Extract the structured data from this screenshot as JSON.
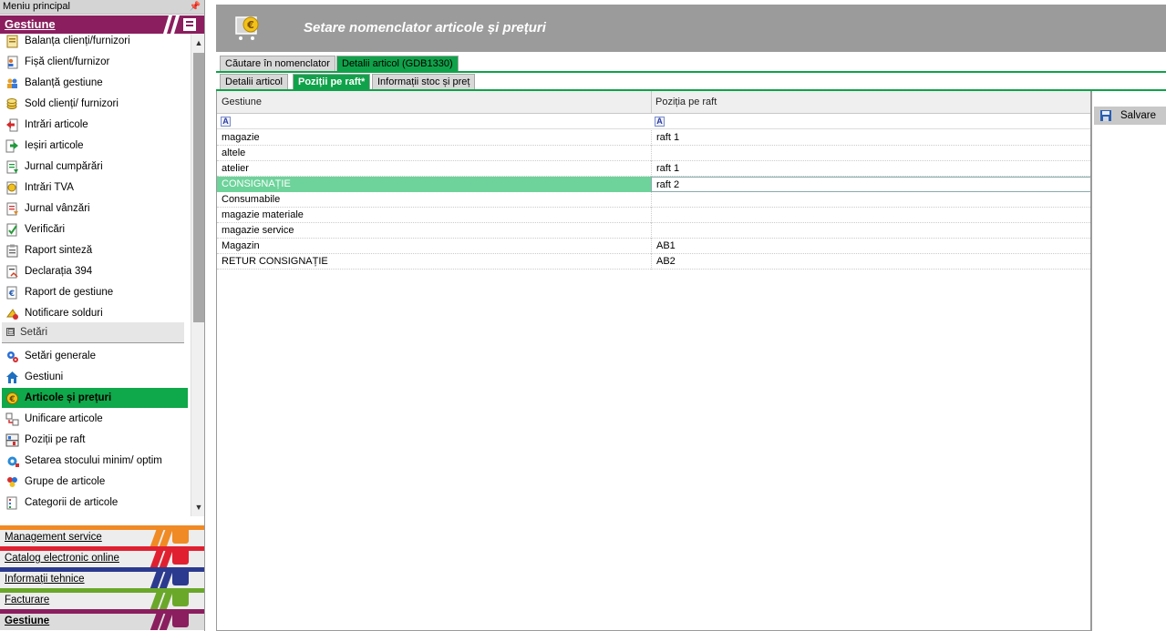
{
  "sidebar": {
    "title": "Meniu principal",
    "pin_icon": "pin-icon",
    "header": "Gestiune",
    "items": [
      {
        "label": "Balanța clienți/furnizori",
        "icon": "report-icon"
      },
      {
        "label": "Fișă client/furnizor",
        "icon": "person-sheet-icon"
      },
      {
        "label": "Balanță gestiune",
        "icon": "people-icon"
      },
      {
        "label": "Sold clienți/ furnizori",
        "icon": "coins-icon"
      },
      {
        "label": "Intrări articole",
        "icon": "arrow-in-icon"
      },
      {
        "label": "Ieșiri articole",
        "icon": "arrow-out-icon"
      },
      {
        "label": "Jurnal cumpărări",
        "icon": "journal-icon"
      },
      {
        "label": "Intrări TVA",
        "icon": "coin-doc-icon"
      },
      {
        "label": "Jurnal vânzări",
        "icon": "journal-sales-icon"
      },
      {
        "label": "Verificări",
        "icon": "check-icon"
      },
      {
        "label": "Raport sinteză",
        "icon": "clipboard-icon"
      },
      {
        "label": "Declarația 394",
        "icon": "declaration-icon"
      },
      {
        "label": "Raport de gestiune",
        "icon": "euro-doc-icon"
      },
      {
        "label": "Notificare solduri",
        "icon": "notify-icon"
      }
    ],
    "section": {
      "label": "Setări",
      "toggle": "⊟"
    },
    "settings_items": [
      {
        "label": "Setări generale",
        "icon": "gears-icon"
      },
      {
        "label": "Gestiuni",
        "icon": "house-icon"
      },
      {
        "label": "Articole și prețuri",
        "icon": "euro-coin-icon",
        "active": true
      },
      {
        "label": "Unificare articole",
        "icon": "merge-icon"
      },
      {
        "label": "Poziții pe raft",
        "icon": "shelf-icon"
      },
      {
        "label": "Setarea stocului minim/ optim",
        "icon": "settings-gear-icon"
      },
      {
        "label": "Grupe de articole",
        "icon": "groups-icon"
      },
      {
        "label": "Categorii de articole",
        "icon": "categories-icon"
      }
    ],
    "modules": [
      {
        "label": "Management service",
        "color": "#f08a24"
      },
      {
        "label": "Catalog electronic online",
        "color": "#e02030"
      },
      {
        "label": "Informații tehnice",
        "color": "#2b3a8f"
      },
      {
        "label": "Facturare",
        "color": "#6aa82a"
      },
      {
        "label": "Gestiune",
        "color": "#8b1e5e"
      }
    ]
  },
  "main": {
    "title": "Setare nomenclator articole și prețuri",
    "banner_icon": "euro-cart-icon",
    "tabs_row1": [
      {
        "label": "Căutare în nomenclator",
        "active": false
      },
      {
        "label": "Detalii articol (GDB1330)",
        "active": true
      }
    ],
    "tabs_row2": [
      {
        "label": "Detalii articol",
        "active": false
      },
      {
        "label": "Poziții pe raft*",
        "active": true
      },
      {
        "label": "Informații stoc și preț",
        "active": false
      }
    ],
    "grid": {
      "columns": [
        "Gestiune",
        "Poziția pe raft"
      ],
      "filter_icon": "A",
      "rows": [
        [
          "magazie",
          "raft 1"
        ],
        [
          "altele",
          ""
        ],
        [
          "atelier",
          "raft 1"
        ],
        [
          "CONSIGNAȚIE",
          "raft 2"
        ],
        [
          "Consumabile",
          ""
        ],
        [
          "magazie materiale",
          ""
        ],
        [
          "magazie service",
          ""
        ],
        [
          "Magazin",
          "AB1"
        ],
        [
          "RETUR CONSIGNAȚIE",
          "AB2"
        ]
      ],
      "selected_row": 3
    },
    "save_label": "Salvare"
  },
  "colors": {
    "accent_green": "#10a24a",
    "selected_row": "#6dd39a",
    "banner_gray": "#9b9b9b",
    "gestiune_purple": "#8b1e5e"
  }
}
